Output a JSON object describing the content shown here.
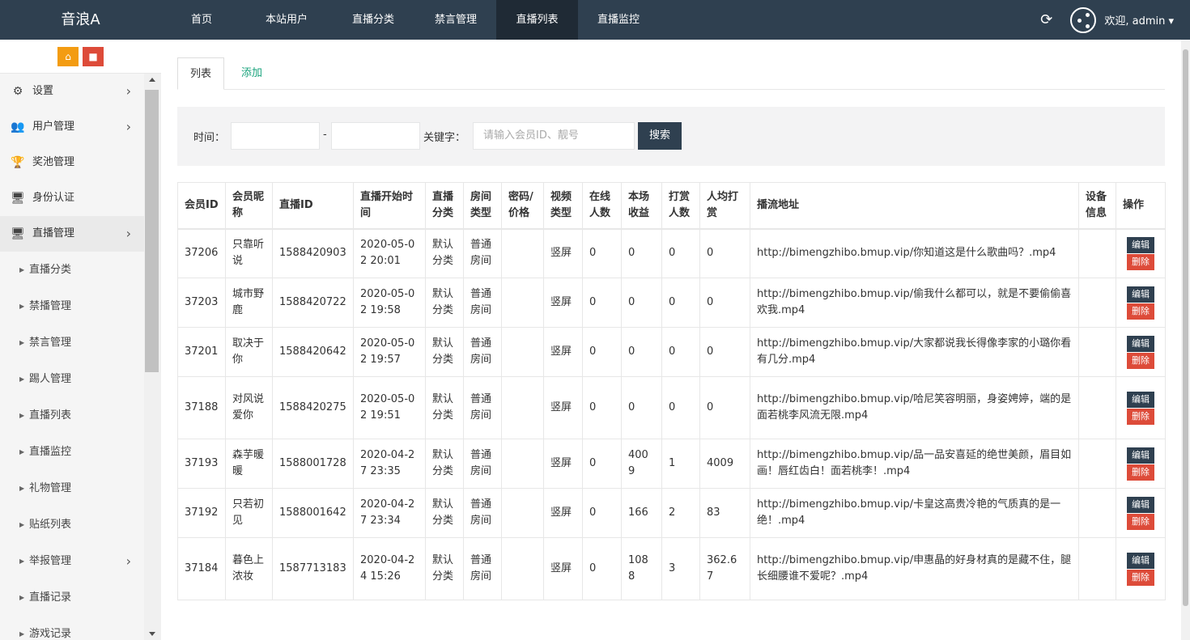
{
  "header": {
    "brand": "音浪A",
    "nav": [
      {
        "label": "首页",
        "width": 100
      },
      {
        "label": "本站用户",
        "width": 110
      },
      {
        "label": "直播分类",
        "width": 104
      },
      {
        "label": "禁言管理",
        "width": 100
      },
      {
        "label": "直播列表",
        "width": 101
      },
      {
        "label": "直播监控",
        "width": 100
      }
    ],
    "active_nav": "直播列表",
    "refresh_icon": "⟳",
    "welcome": "欢迎, admin ▾"
  },
  "sidebar": {
    "home_icon": "⌂",
    "trash_icon": "🗑",
    "menus": [
      {
        "label": "设置",
        "icon": "⚙",
        "has_children": true
      },
      {
        "label": "用户管理",
        "icon": "👥",
        "has_children": true
      },
      {
        "label": "奖池管理",
        "icon": "🏆",
        "has_children": false
      },
      {
        "label": "身份认证",
        "icon": "🖥",
        "has_children": false
      },
      {
        "label": "直播管理",
        "icon": "🖥",
        "has_children": true,
        "active": true
      }
    ],
    "sub_items": [
      {
        "label": "直播分类",
        "has_children": false
      },
      {
        "label": "禁播管理",
        "has_children": false
      },
      {
        "label": "禁言管理",
        "has_children": false
      },
      {
        "label": "踢人管理",
        "has_children": false
      },
      {
        "label": "直播列表",
        "has_children": false
      },
      {
        "label": "直播监控",
        "has_children": false
      },
      {
        "label": "礼物管理",
        "has_children": false
      },
      {
        "label": "贴纸列表",
        "has_children": false
      },
      {
        "label": "举报管理",
        "has_children": true
      },
      {
        "label": "直播记录",
        "has_children": false
      },
      {
        "label": "游戏记录",
        "has_children": false
      }
    ]
  },
  "tabs": {
    "list": "列表",
    "add": "添加"
  },
  "search": {
    "time_label": "时间：",
    "dash": "-",
    "keyword_label": "关键字：",
    "keyword_placeholder": "请输入会员ID、靓号",
    "button": "搜索"
  },
  "table": {
    "columns": [
      "会员ID",
      "会员昵称",
      "直播ID",
      "直播开始时间",
      "直播分类",
      "房间类型",
      "密码/价格",
      "视频类型",
      "在线人数",
      "本场收益",
      "打赏人数",
      "人均打赏",
      "播流地址",
      "设备信息",
      "操作"
    ],
    "edit_label": "编辑",
    "delete_label": "删除",
    "rows": [
      {
        "uid": "37206",
        "nick": "只靠听说",
        "live_id": "1588420903",
        "start": "2020-05-02 20:01",
        "cat": "默认分类",
        "room": "普通房间",
        "pwd": "",
        "video": "竖屏",
        "online": "0",
        "income": "0",
        "tippers": "0",
        "avg": "0",
        "url": "http://bimengzhibo.bmup.vip/你知道这是什么歌曲吗？.mp4",
        "device": ""
      },
      {
        "uid": "37203",
        "nick": "城市野鹿",
        "live_id": "1588420722",
        "start": "2020-05-02 19:58",
        "cat": "默认分类",
        "room": "普通房间",
        "pwd": "",
        "video": "竖屏",
        "online": "0",
        "income": "0",
        "tippers": "0",
        "avg": "0",
        "url": "http://bimengzhibo.bmup.vip/偷我什么都可以，就是不要偷偷喜欢我.mp4",
        "device": ""
      },
      {
        "uid": "37201",
        "nick": "取决于你",
        "live_id": "1588420642",
        "start": "2020-05-02 19:57",
        "cat": "默认分类",
        "room": "普通房间",
        "pwd": "",
        "video": "竖屏",
        "online": "0",
        "income": "0",
        "tippers": "0",
        "avg": "0",
        "url": "http://bimengzhibo.bmup.vip/大家都说我长得像李家的小璐你看有几分.mp4",
        "device": ""
      },
      {
        "uid": "37188",
        "nick": "对风说爱你",
        "live_id": "1588420275",
        "start": "2020-05-02 19:51",
        "cat": "默认分类",
        "room": "普通房间",
        "pwd": "",
        "video": "竖屏",
        "online": "0",
        "income": "0",
        "tippers": "0",
        "avg": "0",
        "url": "http://bimengzhibo.bmup.vip/哈尼笑容明丽，身姿娉婷，端的是面若桃李风流无限.mp4",
        "device": ""
      },
      {
        "uid": "37193",
        "nick": "森芋暖暖",
        "live_id": "1588001728",
        "start": "2020-04-27 23:35",
        "cat": "默认分类",
        "room": "普通房间",
        "pwd": "",
        "video": "竖屏",
        "online": "0",
        "income": "4009",
        "tippers": "1",
        "avg": "4009",
        "url": "http://bimengzhibo.bmup.vip/品一品安喜延的绝世美颜，眉目如画！唇红齿白！面若桃李！.mp4",
        "device": ""
      },
      {
        "uid": "37192",
        "nick": "只若初见",
        "live_id": "1588001642",
        "start": "2020-04-27 23:34",
        "cat": "默认分类",
        "room": "普通房间",
        "pwd": "",
        "video": "竖屏",
        "online": "0",
        "income": "166",
        "tippers": "2",
        "avg": "83",
        "url": "http://bimengzhibo.bmup.vip/卡皇这高贵冷艳的气质真的是一绝！.mp4",
        "device": ""
      },
      {
        "uid": "37184",
        "nick": "暮色上浓妆",
        "live_id": "1587713183",
        "start": "2020-04-24 15:26",
        "cat": "默认分类",
        "room": "普通房间",
        "pwd": "",
        "video": "竖屏",
        "online": "0",
        "income": "1088",
        "tippers": "3",
        "avg": "362.67",
        "url": "http://bimengzhibo.bmup.vip/申惠晶的好身材真的是藏不住，腿长细腰谁不爱呢？.mp4",
        "device": ""
      }
    ]
  }
}
